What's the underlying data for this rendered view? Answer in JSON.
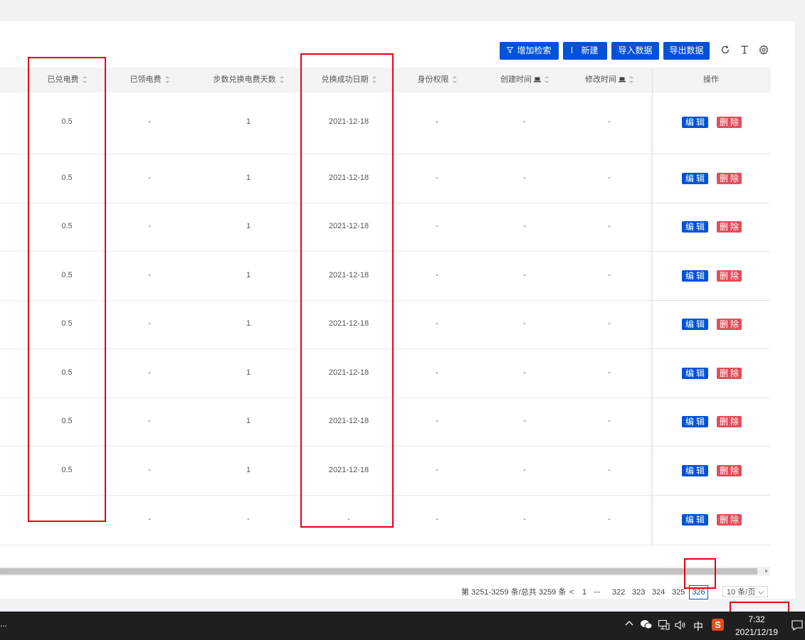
{
  "toolbar": {
    "add_filter_label": "增加检索",
    "new_label": "新建",
    "import_label": "导入数据",
    "export_label": "导出数据",
    "refresh_icon": "refresh-icon",
    "column_height_icon": "text-height-icon",
    "settings_icon": "settings-icon"
  },
  "table": {
    "columns": [
      {
        "label": "已兑电费",
        "sortable": true
      },
      {
        "label": "已领电费",
        "sortable": true
      },
      {
        "label": "步数兑换电费天数",
        "sortable": true
      },
      {
        "label": "兑换成功日期",
        "sortable": true
      },
      {
        "label": "身份权限",
        "sortable": true
      },
      {
        "label": "创建时间",
        "sortable": true,
        "icon": "laptop-icon"
      },
      {
        "label": "修改时间",
        "sortable": true,
        "icon": "laptop-icon"
      },
      {
        "label": "操作",
        "sortable": false
      }
    ],
    "rows": [
      {
        "paid": "0.5",
        "received": "-",
        "days": "1",
        "date": "2021-12-18",
        "role": "-",
        "created": "-",
        "modified": "-"
      },
      {
        "paid": "0.5",
        "received": "-",
        "days": "1",
        "date": "2021-12-18",
        "role": "-",
        "created": "-",
        "modified": "-"
      },
      {
        "paid": "0.5",
        "received": "-",
        "days": "1",
        "date": "2021-12-18",
        "role": "-",
        "created": "-",
        "modified": "-"
      },
      {
        "paid": "0.5",
        "received": "-",
        "days": "1",
        "date": "2021-12-18",
        "role": "-",
        "created": "-",
        "modified": "-"
      },
      {
        "paid": "0.5",
        "received": "-",
        "days": "1",
        "date": "2021-12-18",
        "role": "-",
        "created": "-",
        "modified": "-"
      },
      {
        "paid": "0.5",
        "received": "-",
        "days": "1",
        "date": "2021-12-18",
        "role": "-",
        "created": "-",
        "modified": "-"
      },
      {
        "paid": "0.5",
        "received": "-",
        "days": "1",
        "date": "2021-12-18",
        "role": "-",
        "created": "-",
        "modified": "-"
      },
      {
        "paid": "0.5",
        "received": "-",
        "days": "1",
        "date": "2021-12-18",
        "role": "-",
        "created": "-",
        "modified": "-"
      },
      {
        "paid": "",
        "received": "-",
        "days": "-",
        "date": "-",
        "role": "-",
        "created": "-",
        "modified": "-"
      }
    ],
    "edit_label": "编辑",
    "delete_label": "删除"
  },
  "pagination": {
    "summary": "第 3251-3259 条/总共 3259 条",
    "prev": "<",
    "first": "1",
    "ellipsis": "•••",
    "pages": [
      "322",
      "323",
      "324",
      "325"
    ],
    "current": "326",
    "page_size": "10 条/页"
  },
  "taskbar": {
    "left_text": "...",
    "ime_label": "中",
    "sogou_label": "S",
    "time": "7:32",
    "date": "2021/12/19"
  },
  "colors": {
    "primary": "#0052d9",
    "danger": "#e34d59",
    "highlight": "#e60012"
  }
}
